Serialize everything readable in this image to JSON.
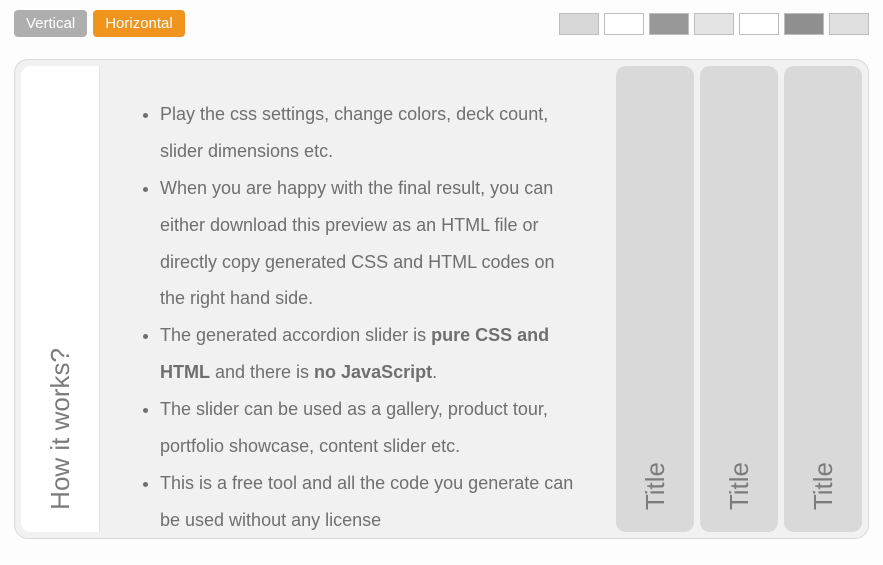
{
  "orientation": {
    "vertical": "Vertical",
    "horizontal": "Horizontal",
    "active": "horizontal"
  },
  "swatches": [
    "#d8d8d8",
    "#ffffff",
    "#989898",
    "#e4e4e4",
    "#ffffff",
    "#8f8f8f",
    "#e0e0e0"
  ],
  "accordion": {
    "open_tab": "How it works?",
    "closed_tabs": [
      "Title",
      "Title",
      "Title"
    ],
    "content_items": [
      {
        "text": "Play the css settings, change colors, deck count, slider dimensions etc."
      },
      {
        "text": "When you are happy with the final result, you can either download this preview as an HTML file or directly copy generated CSS and HTML codes on the right hand side."
      },
      {
        "html": "The generated accordion slider is <b>pure CSS and HTML</b> and there is <b>no JavaScript</b>."
      },
      {
        "text": "The slider can be used as a gallery, product tour, portfolio showcase, content slider etc."
      },
      {
        "text": "This is a free tool and all the code you generate can be used without any license"
      }
    ]
  }
}
